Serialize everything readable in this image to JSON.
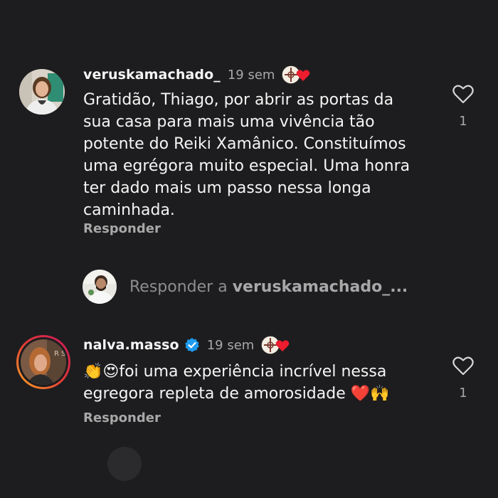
{
  "comments": [
    {
      "username": "veruskamachado_",
      "time": "19 sem",
      "text": "Gratidão, Thiago, por abrir as portas da\nsua casa para mais uma vivência tão\npotente do Reiki Xamânico. Constituímos\numa egrégora muito especial. Uma honra\nter dado mais um passo nessa longa\ncaminhada.",
      "reply_label": "Responder",
      "likes": "1",
      "creator_liked_icon": "creator-heart-badge-icon",
      "avatar_icon": "user-avatar-icon"
    },
    {
      "username": "nalva.masso",
      "time": "19 sem",
      "text": "👏😍foi uma experiência incrível nessa\negregora repleta de amorosidade ❤️🙌",
      "reply_label": "Responder",
      "likes": "1",
      "verified": true,
      "creator_liked_icon": "creator-heart-badge-icon",
      "avatar_icon": "user-avatar-icon"
    }
  ],
  "reply_box": {
    "prompt": "Responder a ",
    "target": "veruskamachado_..."
  },
  "colors": {
    "background": "#1d1d1f",
    "text": "#f5f5f5",
    "muted": "#a8a8a8",
    "verified": "#1d9bf0",
    "heart_red": "#ed1c2e",
    "story_ring_start": "#f9a825",
    "story_ring_end": "#c2185b"
  }
}
